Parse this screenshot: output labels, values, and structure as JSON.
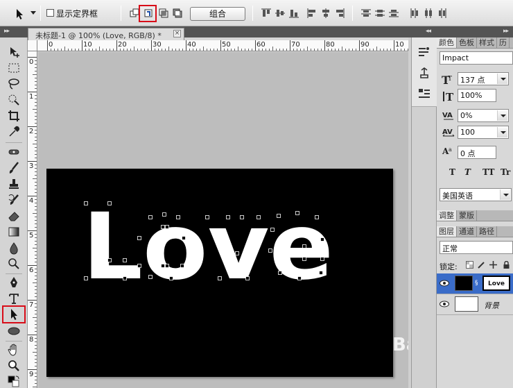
{
  "options_bar": {
    "show_bounding_box_label": "显示定界框",
    "combine_button_label": "组合"
  },
  "document": {
    "tab_title": "未标题-1 @ 100% (Love, RGB/8) *",
    "close_glyph": "×",
    "canvas_text": "Love"
  },
  "rulers": {
    "horizontal": [
      "0",
      "10",
      "20",
      "30",
      "40",
      "50",
      "60",
      "70",
      "80",
      "90",
      "10"
    ],
    "vertical": [
      "0",
      "1",
      "2",
      "3",
      "4",
      "5",
      "6",
      "7",
      "8",
      "9"
    ]
  },
  "panel_tabs_top": [
    "颜色",
    "色板",
    "样式",
    "历"
  ],
  "character": {
    "font_family": "Impact",
    "font_size": "137 点",
    "vertical_scale": "100%",
    "tracking_pct": "0%",
    "tracking": "100",
    "baseline_shift": "0 点",
    "style_buttons": [
      "T",
      "T",
      "TT",
      "Tr"
    ],
    "language": "美国英语"
  },
  "panel_tabs_adjust": [
    "调整",
    "蒙版"
  ],
  "panel_tabs_layers": [
    "图层",
    "通道",
    "路径"
  ],
  "layers": {
    "blend_mode": "正常",
    "lock_label": "锁定:",
    "items": [
      {
        "name": "Love",
        "thumb_text": "Love",
        "selected": true
      },
      {
        "name": "背景",
        "selected": false
      }
    ]
  },
  "watermark": {
    "text": "Bai 经验",
    "color": "#ffffff"
  },
  "colors": {
    "highlight_red": "#d80c18",
    "layer_selected": "#3a6cc8",
    "canvas_bg": "#000000"
  },
  "icons": [
    "move-icon",
    "marquee-icon",
    "lasso-icon",
    "quick-select-icon",
    "crop-icon",
    "eyedropper-icon",
    "healing-icon",
    "brush-icon",
    "stamp-icon",
    "history-brush-icon",
    "eraser-icon",
    "gradient-icon",
    "blur-icon",
    "dodge-icon",
    "pen-icon",
    "type-icon",
    "path-select-icon",
    "ellipse-icon",
    "hand-icon",
    "zoom-icon"
  ]
}
